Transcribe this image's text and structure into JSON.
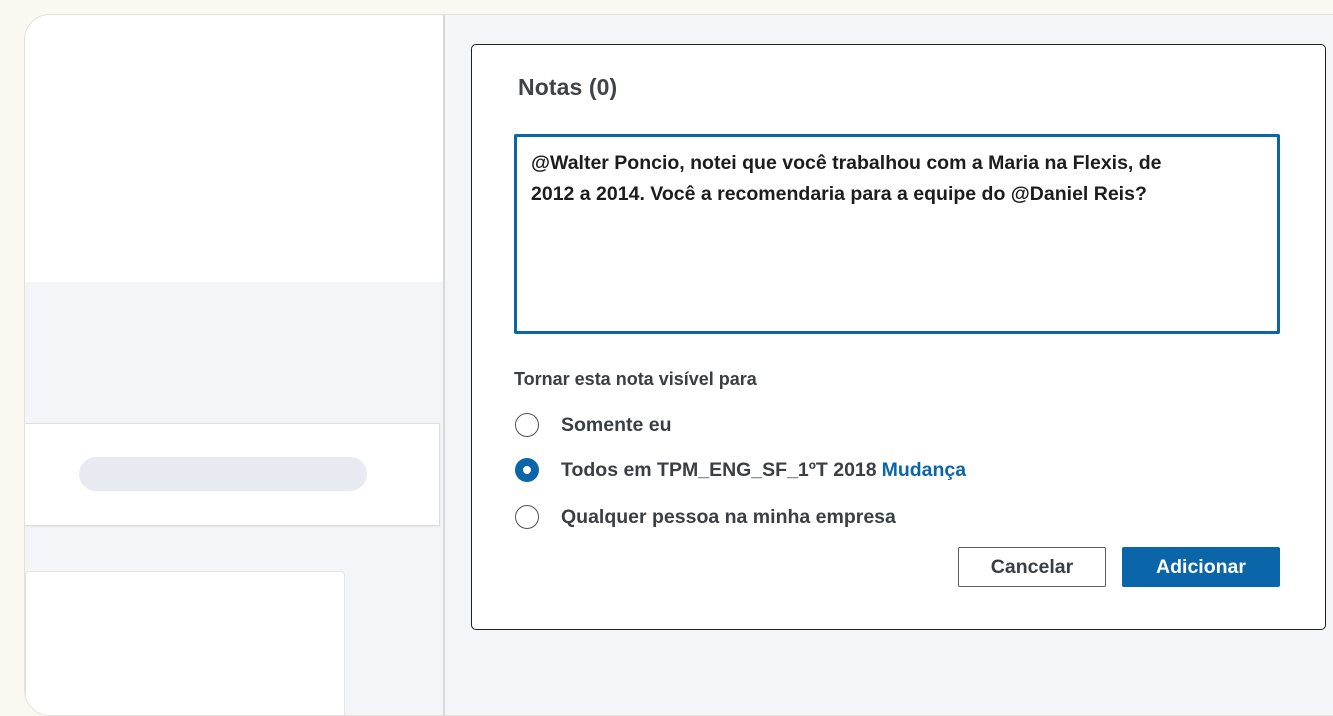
{
  "notes_dialog": {
    "title": "Notas (0)",
    "note_text": "@Walter Poncio, notei que você trabalhou com a Maria na Flexis, de 2012 a 2014. Você a recomendaria para a equipe do @Daniel Reis?",
    "visibility_label": "Tornar esta nota visível para",
    "visibility_options": [
      {
        "label": "Somente eu",
        "selected": false
      },
      {
        "label": "Todos em TPM_ENG_SF_1ºT 2018",
        "selected": true,
        "link": "Mudança"
      },
      {
        "label": "Qualquer pessoa na minha empresa",
        "selected": false
      }
    ],
    "cancel_label": "Cancelar",
    "add_label": "Adicionar"
  },
  "colors": {
    "accent": "#0a66a8",
    "page_bg": "#fbf7f1",
    "pane_bg": "#f3f5f8",
    "text": "#3a3f44"
  }
}
